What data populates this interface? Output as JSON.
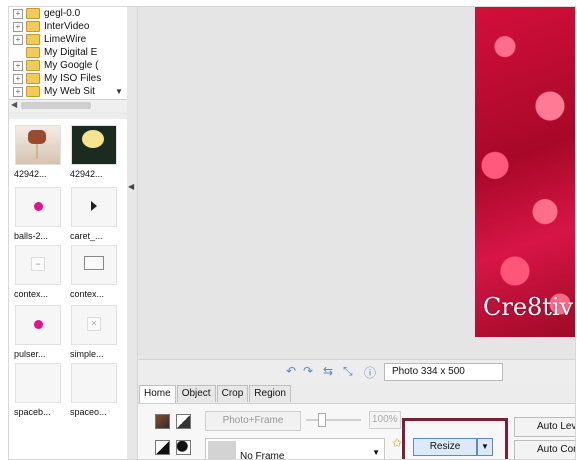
{
  "tree": {
    "items": [
      {
        "label": "gegl-0.0",
        "expander": "+"
      },
      {
        "label": "InterVideo",
        "expander": "+"
      },
      {
        "label": "LimeWire",
        "expander": "+"
      },
      {
        "label": "My Digital E",
        "expander": ""
      },
      {
        "label": "My Google (",
        "expander": "+"
      },
      {
        "label": "My ISO Files",
        "expander": "+"
      },
      {
        "label": "My Web Sit",
        "expander": "+"
      }
    ]
  },
  "thumbnails": [
    {
      "label": "42942...",
      "icon": "bottle-photo"
    },
    {
      "label": "42942...",
      "icon": "flower-photo"
    },
    {
      "label": "balls-2...",
      "icon": "pink-dot-icon"
    },
    {
      "label": "caret_...",
      "icon": "caret-icon"
    },
    {
      "label": "contex...",
      "icon": "minus-icon"
    },
    {
      "label": "contex...",
      "icon": "monitor-icon"
    },
    {
      "label": "pulser...",
      "icon": "pink-dot-icon"
    },
    {
      "label": "simple...",
      "icon": "x-icon"
    },
    {
      "label": "spaceb...",
      "icon": "blank"
    },
    {
      "label": "spaceo...",
      "icon": "blank"
    }
  ],
  "canvas": {
    "watermark": "Cre8tiv",
    "photo_size": "Photo 334 x 500"
  },
  "toolstrip": {
    "icons": [
      "rotate-left-icon",
      "rotate-right-icon",
      "flip-icon",
      "resize-icon",
      "info-icon"
    ]
  },
  "ribbon": {
    "tabs": [
      "Home",
      "Object",
      "Crop",
      "Region"
    ],
    "photo_frame": "Photo+Frame",
    "zoom": "100%",
    "frame_select": "No Frame",
    "resize": "Resize",
    "auto_levels": "Auto Lev",
    "auto_contrast": "Auto Contr"
  },
  "colors": {
    "accent_border": "#7a1f3b",
    "button_blue": "#dce9f8",
    "photo_red": "#d30f3c"
  }
}
